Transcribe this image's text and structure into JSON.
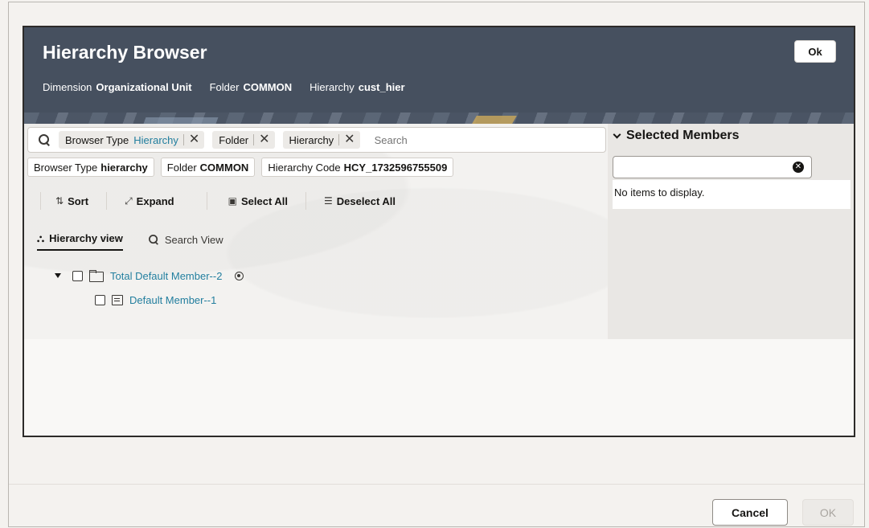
{
  "dialog": {
    "title": "Hierarchy Browser",
    "ok_label": "Ok",
    "meta": [
      {
        "label": "Dimension",
        "value": "Organizational Unit"
      },
      {
        "label": "Folder",
        "value": "COMMON"
      },
      {
        "label": "Hierarchy",
        "value": "cust_hier"
      }
    ]
  },
  "search": {
    "chips": [
      {
        "label": "Browser Type",
        "value": "Hierarchy"
      },
      {
        "label": "Folder",
        "value": ""
      },
      {
        "label": "Hierarchy",
        "value": ""
      }
    ],
    "placeholder": "Search"
  },
  "filters": [
    {
      "label": "Browser Type",
      "value": "hierarchy"
    },
    {
      "label": "Folder",
      "value": "COMMON"
    },
    {
      "label": "Hierarchy Code",
      "value": "HCY_1732596755509"
    }
  ],
  "toolbar": {
    "sort_label": "Sort",
    "expand_label": "Expand",
    "select_all_label": "Select All",
    "deselect_all_label": "Deselect All"
  },
  "tabs": {
    "hierarchy_view": "Hierarchy view",
    "search_view": "Search View"
  },
  "tree": {
    "root": "Total Default Member--2",
    "children": [
      "Default Member--1"
    ]
  },
  "selected_members": {
    "title": "Selected Members",
    "empty_text": "No items to display."
  },
  "footer": {
    "cancel_label": "Cancel",
    "ok_label": "OK"
  },
  "colors": {
    "header_bg": "#46505f",
    "link": "#227e9e"
  }
}
